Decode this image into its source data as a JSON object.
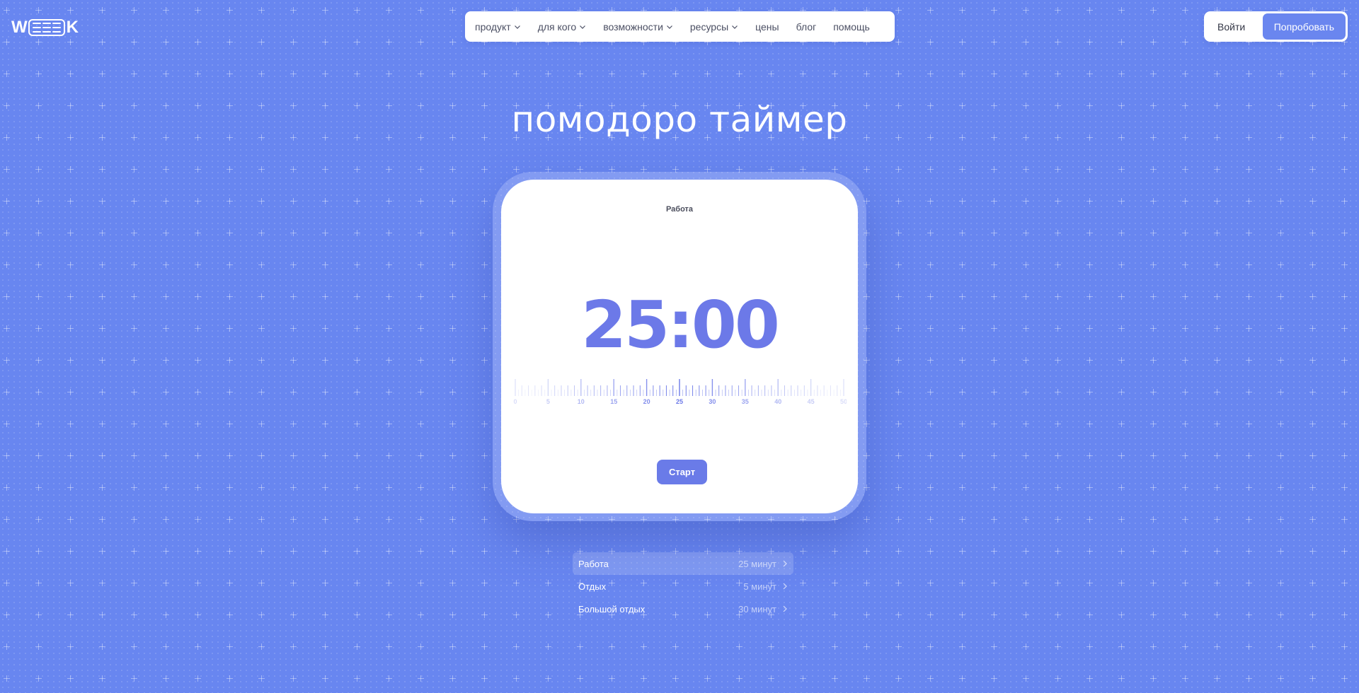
{
  "brand": {
    "logo_first": "W",
    "logo_last": "K"
  },
  "nav": {
    "items": [
      {
        "label": "продукт",
        "has_dropdown": true
      },
      {
        "label": "для кого",
        "has_dropdown": true
      },
      {
        "label": "возможности",
        "has_dropdown": true
      },
      {
        "label": "ресурсы",
        "has_dropdown": true
      },
      {
        "label": "цены",
        "has_dropdown": false
      },
      {
        "label": "блог",
        "has_dropdown": false
      },
      {
        "label": "помощь",
        "has_dropdown": false
      }
    ]
  },
  "auth": {
    "login_label": "Войти",
    "try_label": "Попробовать"
  },
  "page": {
    "title": "помодоро таймер"
  },
  "timer": {
    "mode_label": "Работа",
    "time": "25:00",
    "selected_minutes": 25,
    "ruler_labels": [
      "0",
      "5",
      "10",
      "15",
      "20",
      "25",
      "30",
      "35",
      "40",
      "45",
      "50"
    ],
    "start_label": "Старт",
    "accent_color": "#6c79e8"
  },
  "modes": [
    {
      "name": "Работа",
      "duration": "25 минут",
      "active": true
    },
    {
      "name": "Отдых",
      "duration": "5 минут",
      "active": false
    },
    {
      "name": "Большой отдых",
      "duration": "30 минут",
      "active": false
    }
  ],
  "colors": {
    "background": "#6886f0",
    "button": "#6a86ef"
  }
}
